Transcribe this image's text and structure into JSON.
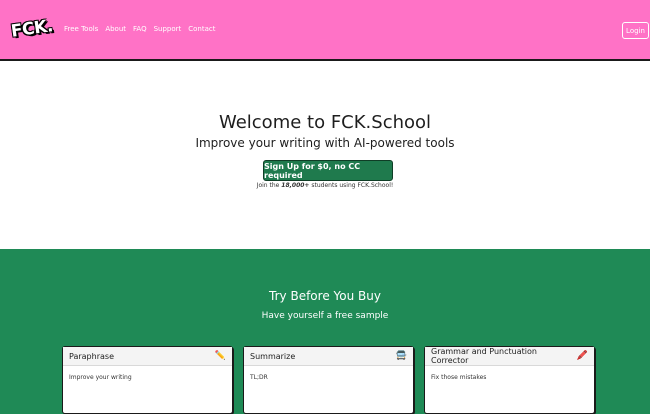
{
  "brand": {
    "logo_text": "FCK."
  },
  "nav": {
    "links": [
      "Free Tools",
      "About",
      "FAQ",
      "Support",
      "Contact"
    ],
    "login_label": "Login"
  },
  "hero": {
    "title": "Welcome to FCK.School",
    "subtitle": "Improve your writing with AI-powered tools",
    "cta_label": "Sign Up for $0, no CC required",
    "social_prefix": "Join the ",
    "social_count": "18,000+",
    "social_suffix": " students using FCK.School!"
  },
  "tools_section": {
    "title": "Try Before You Buy",
    "subtitle": "Have yourself a free sample",
    "cards": [
      {
        "title": "Paraphrase",
        "icon": "pencil-icon",
        "glyph": "✏️",
        "description": "Improve your writing"
      },
      {
        "title": "Summarize",
        "icon": "bus-icon",
        "glyph": "🚍",
        "description": "TL;DR"
      },
      {
        "title": "Grammar and Punctuation Corrector",
        "icon": "red-pencil-icon",
        "glyph": "🖍️",
        "description": "Fix those mistakes"
      }
    ]
  },
  "colors": {
    "nav_bg": "#ff72c6",
    "section_bg": "#1f8a56",
    "cta_bg": "#1f7a4d"
  }
}
